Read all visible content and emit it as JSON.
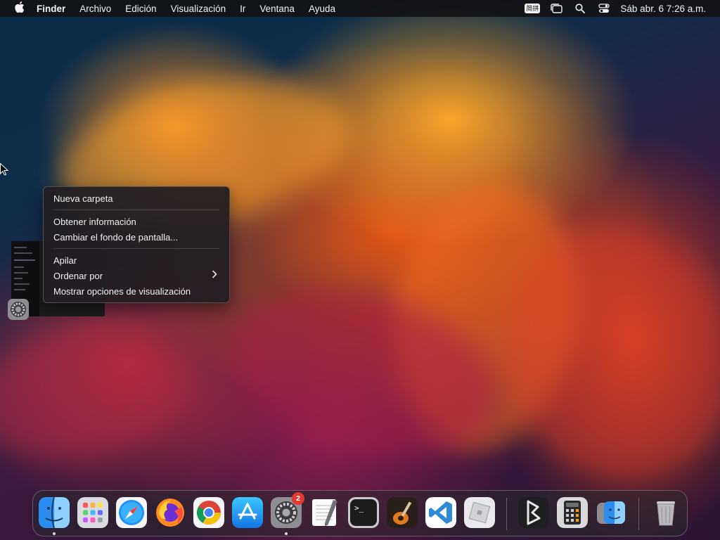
{
  "menubar": {
    "app_name": "Finder",
    "items": [
      "Archivo",
      "Edición",
      "Visualización",
      "Ir",
      "Ventana",
      "Ayuda"
    ],
    "input_method": "简拼",
    "clock": "Sáb abr. 6  7:26 a.m."
  },
  "context_menu": {
    "groups": [
      [
        "Nueva carpeta"
      ],
      [
        "Obtener información",
        "Cambiar el fondo de pantalla..."
      ],
      [
        "Apilar",
        "Ordenar por",
        "Mostrar opciones de visualización"
      ]
    ]
  },
  "dock": {
    "apps": [
      {
        "name": "finder-icon",
        "running": true
      },
      {
        "name": "launchpad-icon",
        "running": false
      },
      {
        "name": "safari-icon",
        "running": false
      },
      {
        "name": "firefox-icon",
        "running": false
      },
      {
        "name": "chrome-icon",
        "running": false
      },
      {
        "name": "app-store-icon",
        "running": false
      },
      {
        "name": "system-settings-icon",
        "running": true,
        "badge": "2"
      },
      {
        "name": "textedit-icon",
        "running": false
      },
      {
        "name": "terminal-icon",
        "running": false
      },
      {
        "name": "garageband-icon",
        "running": false
      },
      {
        "name": "vscode-icon",
        "running": false
      },
      {
        "name": "roblox-icon",
        "running": false
      },
      {
        "name": "bbedit-icon",
        "running": false
      },
      {
        "name": "calculator-icon",
        "running": false
      },
      {
        "name": "finder-recent-icon",
        "running": false
      },
      {
        "name": "trash-icon",
        "running": false
      }
    ],
    "terminal_prompt": ">_"
  },
  "colors": {
    "menubar_bg": "#121216",
    "menu_bg": "#221e22",
    "badge": "#e0392f",
    "vscode_blue": "#2f8ad8"
  }
}
